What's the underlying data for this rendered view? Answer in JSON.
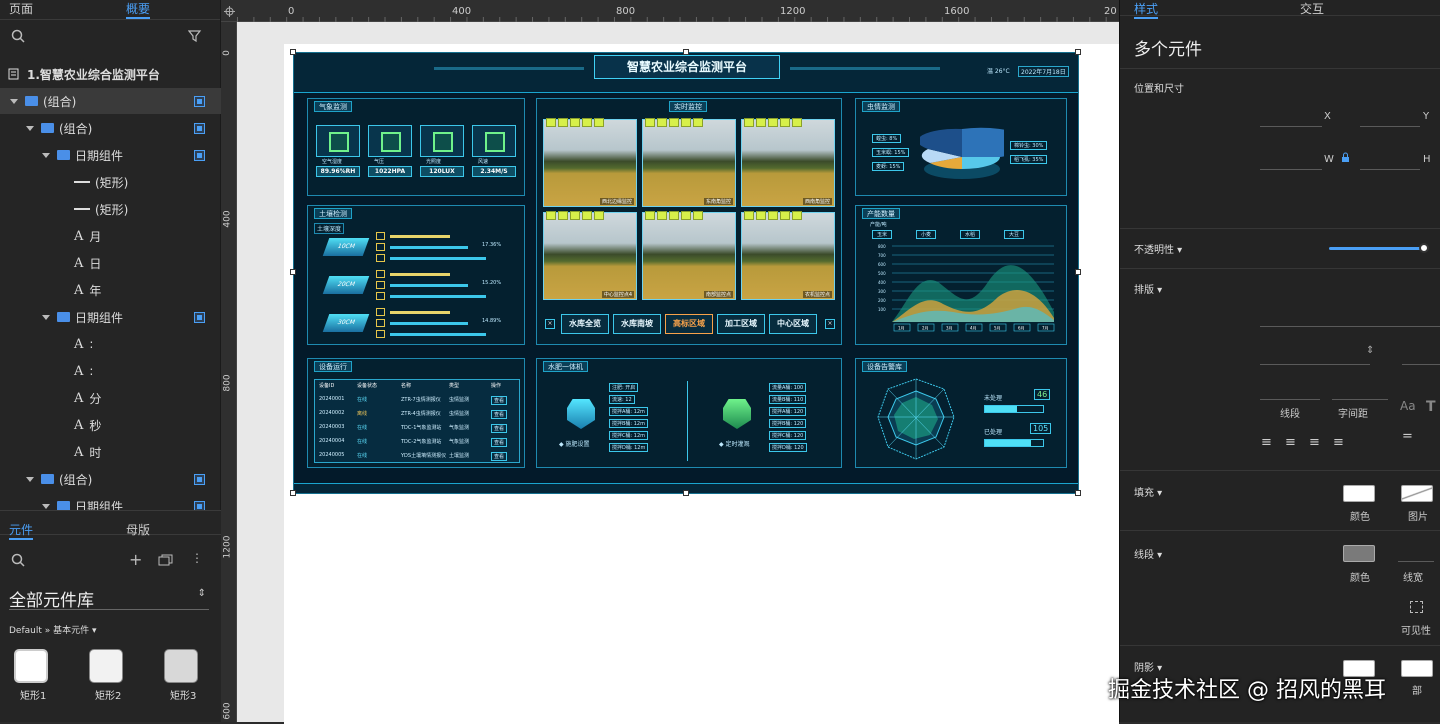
{
  "left_panel": {
    "tabs": [
      "页面",
      "概要"
    ],
    "active_tab": "概要",
    "page_name": "1.智慧农业综合监测平台",
    "tree": [
      {
        "label": "(组合)",
        "type": "folder",
        "depth": 0,
        "selected": true,
        "checked": true
      },
      {
        "label": "(组合)",
        "type": "folder",
        "depth": 1,
        "checked": true
      },
      {
        "label": "日期组件",
        "type": "folder",
        "depth": 2,
        "checked": true
      },
      {
        "label": "(矩形)",
        "type": "rect",
        "depth": 3
      },
      {
        "label": "(矩形)",
        "type": "rect",
        "depth": 3
      },
      {
        "label": "月",
        "type": "text",
        "depth": 3
      },
      {
        "label": "日",
        "type": "text",
        "depth": 3
      },
      {
        "label": "年",
        "type": "text",
        "depth": 3
      },
      {
        "label": "日期组件",
        "type": "folder",
        "depth": 2,
        "checked": true
      },
      {
        "label": ":",
        "type": "text",
        "depth": 3
      },
      {
        "label": ":",
        "type": "text",
        "depth": 3
      },
      {
        "label": "分",
        "type": "text",
        "depth": 3
      },
      {
        "label": "秒",
        "type": "text",
        "depth": 3
      },
      {
        "label": "时",
        "type": "text",
        "depth": 3
      },
      {
        "label": "(组合)",
        "type": "folder",
        "depth": 1,
        "checked": true
      },
      {
        "label": "日期组件",
        "type": "folder",
        "depth": 2,
        "checked": true
      }
    ],
    "lib_tabs": [
      "元件",
      "母版"
    ],
    "active_lib_tab": "元件",
    "library_name": "全部元件库",
    "library_path": "Default » 基本元件",
    "widgets": [
      "矩形1",
      "矩形2",
      "矩形3"
    ]
  },
  "rulers": {
    "top": [
      "0",
      "400",
      "800",
      "1200",
      "1600",
      "20"
    ],
    "left": [
      "0",
      "400",
      "800",
      "1200",
      "600"
    ]
  },
  "dashboard": {
    "title": "智慧农业综合监测平台",
    "header_temp": "温 26°C",
    "header_date": "2022年7月18日",
    "weather": {
      "title": "气象监测",
      "items": [
        {
          "label": "空气湿度",
          "value": "89.96%RH"
        },
        {
          "label": "气压",
          "value": "1022HPA"
        },
        {
          "label": "光照度",
          "value": "120LUX"
        },
        {
          "label": "风速",
          "value": "2.34M/S"
        }
      ]
    },
    "soil": {
      "title": "土壤检测",
      "subtitle": "土壤深度",
      "tags": [
        "10CM",
        "20CM",
        "30CM"
      ],
      "values": [
        "17.36%",
        "15.20%",
        "14.89%"
      ]
    },
    "field": {
      "title": "实时监控",
      "captions": [
        "西北边缘监控",
        "东南角监控",
        "西南角监控",
        "中心监控点4",
        "南部监控点",
        "农机监控点"
      ],
      "buttons": [
        "水库全览",
        "水库南坡",
        "高标区域",
        "加工区域",
        "中心区域"
      ],
      "active_button": "高标区域"
    },
    "pests": {
      "title": "虫情监测",
      "left": [
        {
          "label": "蝗虫",
          "value": "8%"
        },
        {
          "label": "玉米螟",
          "value": "15%"
        },
        {
          "label": "麦蚜",
          "value": "15%"
        }
      ],
      "right": [
        {
          "label": "棉铃虫",
          "value": "30%"
        },
        {
          "label": "稻飞虱",
          "value": "35%"
        }
      ]
    },
    "yield": {
      "title": "产能数量",
      "unit": "产能/吨",
      "legend": [
        "玉米",
        "小麦",
        "水稻",
        "大豆"
      ],
      "months": [
        "1月",
        "2月",
        "3月",
        "4月",
        "5月",
        "6月",
        "7月"
      ],
      "yticks": [
        "800",
        "700",
        "600",
        "500",
        "400",
        "300",
        "200",
        "100"
      ]
    },
    "devices": {
      "title": "设备运行",
      "headers": [
        "设备ID",
        "设备状态",
        "名称",
        "类型",
        "操作"
      ],
      "rows": [
        [
          "20240001",
          "在线",
          "ZTR-7虫情测报仪",
          "虫情监测",
          "查看"
        ],
        [
          "20240002",
          "离线",
          "ZTR-4虫情测报仪",
          "虫情监测",
          "查看"
        ],
        [
          "20240003",
          "在线",
          "TDC-1气象监测站",
          "气象监测",
          "查看"
        ],
        [
          "20240004",
          "在线",
          "TDC-2气象监测站",
          "气象监测",
          "查看"
        ],
        [
          "20240005",
          "在线",
          "YDS土壤墒情测报仪",
          "土壤监测",
          "查看"
        ]
      ]
    },
    "water": {
      "title": "水肥一体机",
      "left_labels": [
        "注肥:",
        "流速:",
        "搅拌A桶:",
        "搅拌B桶:",
        "搅拌C桶:",
        "搅拌D桶:"
      ],
      "left_values": [
        "开启",
        "12",
        "12m",
        "12m",
        "12m",
        "12m"
      ],
      "right_labels": [
        "流量A桶:",
        "流量B桶:",
        "搅拌A桶:",
        "搅拌B桶:",
        "搅拌C桶:",
        "搅拌D桶:"
      ],
      "right_values": [
        "100",
        "110",
        "120",
        "120",
        "120",
        "120"
      ],
      "tank_left": "施肥设置",
      "tank_right": "定时灌溉"
    },
    "alerts": {
      "title": "设备告警库",
      "labels": [
        "未处理",
        "已处理"
      ],
      "values": [
        "46",
        "105"
      ]
    }
  },
  "right_panel": {
    "tabs": [
      "样式",
      "交互"
    ],
    "active_tab": "样式",
    "heading": "多个元件",
    "position_size": "位置和尺寸",
    "x": "X",
    "y": "Y",
    "w": "W",
    "h": "H",
    "opacity": "不透明性",
    "layout": "排版",
    "stroke_label": "线段",
    "spacing_label": "字间距",
    "fill": "填充",
    "fill_color": "颜色",
    "fill_image": "图片",
    "line": "线段",
    "line_color": "颜色",
    "line_width": "线宽",
    "visibility": "可见性",
    "shadow": "阴影",
    "shadow_outer": "部"
  },
  "watermark": "掘金技术社区 @ 招风的黑耳"
}
